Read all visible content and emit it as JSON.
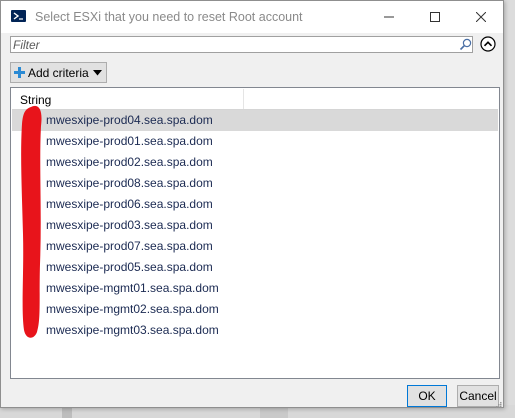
{
  "window": {
    "title": "Select ESXi that you need to reset Root account"
  },
  "filter": {
    "placeholder": "Filter"
  },
  "add_criteria": {
    "label": "Add criteria"
  },
  "grid": {
    "columns": [
      "String",
      ""
    ],
    "rows": [
      "mwesxipe-prod04.sea.spa.dom",
      "mwesxipe-prod01.sea.spa.dom",
      "mwesxipe-prod02.sea.spa.dom",
      "mwesxipe-prod08.sea.spa.dom",
      "mwesxipe-prod06.sea.spa.dom",
      "mwesxipe-prod03.sea.spa.dom",
      "mwesxipe-prod07.sea.spa.dom",
      "mwesxipe-prod05.sea.spa.dom",
      "mwesxipe-mgmt01.sea.spa.dom",
      "mwesxipe-mgmt02.sea.spa.dom",
      "mwesxipe-mgmt03.sea.spa.dom"
    ],
    "selected_row": 0
  },
  "buttons": {
    "ok": "OK",
    "cancel": "Cancel"
  },
  "colors": {
    "redaction": "#e8141b",
    "selection": "#d9d9d9",
    "row_text": "#1b2a52",
    "accent": "#0078d7"
  },
  "icons": {
    "app": "powershell-icon",
    "search": "search-icon",
    "collapse": "chevron-up-circle-icon",
    "add": "plus-icon",
    "dropdown": "caret-down-icon"
  }
}
